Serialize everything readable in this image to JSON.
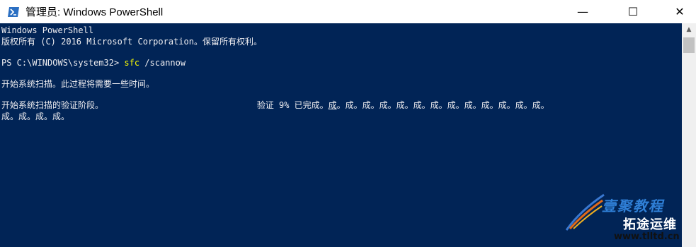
{
  "window": {
    "title": "管理员: Windows PowerShell",
    "minimize_glyph": "—",
    "maximize_glyph": "☐",
    "close_glyph": "✕"
  },
  "console": {
    "background": "#012456",
    "foreground": "#EEEDF0",
    "command_color": "#FFFF00",
    "lines": {
      "banner1": "Windows PowerShell",
      "banner2": "版权所有 (C) 2016 Microsoft Corporation。保留所有权利。",
      "prompt": "PS C:\\WINDOWS\\system32> ",
      "command": "sfc",
      "command_arg": " /scannow",
      "start_scan": "开始系统扫描。此过程将需要一些时间。",
      "verify_phase_prefix": "开始系统扫描的验证阶段。                              验证 9% 已完成。",
      "verify_cursor_char": "成",
      "verify_phase_suffix": "。成。成。成。成。成。成。成。成。成。成。成。成。",
      "verify_wrap": "成。成。成。成。"
    }
  },
  "watermark": {
    "text1": "壹聚教程",
    "text2": "拓途运维",
    "url": "www.tlltd.cn"
  }
}
